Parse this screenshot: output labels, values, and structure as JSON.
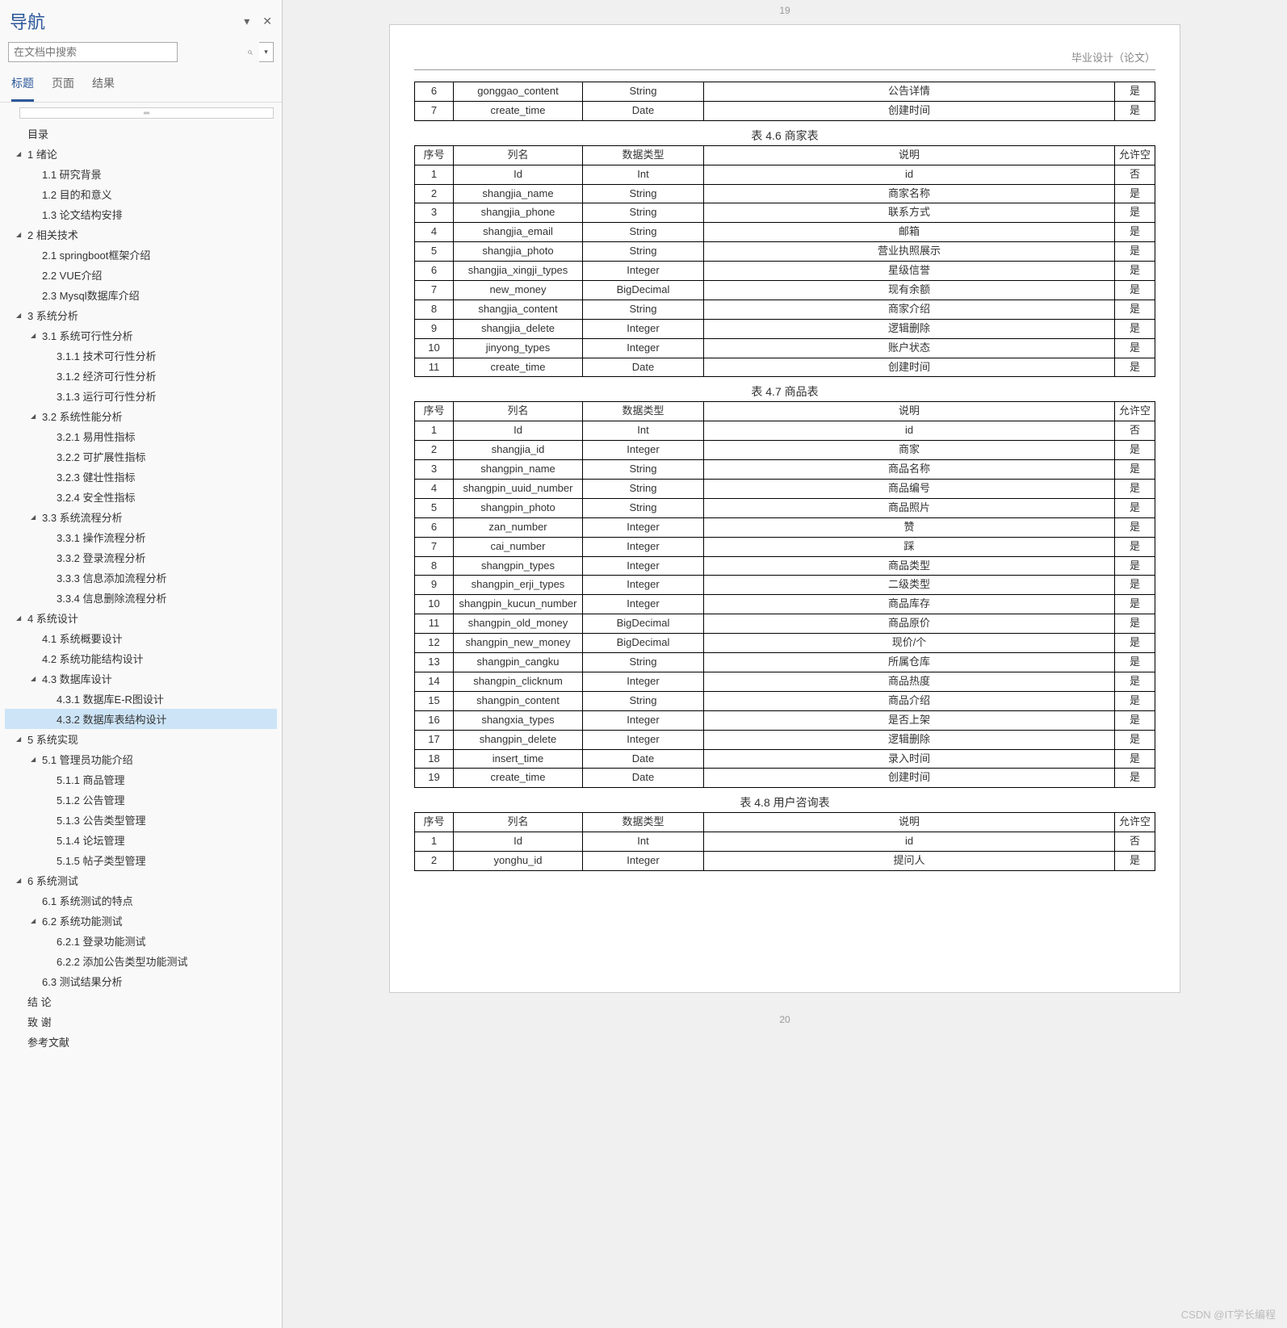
{
  "nav": {
    "title": "导航",
    "searchPlaceholder": "在文档中搜索",
    "tabs": {
      "headings": "标题",
      "pages": "页面",
      "results": "结果"
    },
    "zoomHandle": "⇅"
  },
  "tree": [
    {
      "level": 0,
      "arrow": "",
      "label": "目录"
    },
    {
      "level": 0,
      "arrow": "exp",
      "label": "1 绪论"
    },
    {
      "level": 1,
      "arrow": "",
      "label": "1.1 研究背景"
    },
    {
      "level": 1,
      "arrow": "",
      "label": "1.2 目的和意义"
    },
    {
      "level": 1,
      "arrow": "",
      "label": "1.3 论文结构安排"
    },
    {
      "level": 0,
      "arrow": "exp",
      "label": "2 相关技术"
    },
    {
      "level": 1,
      "arrow": "",
      "label": "2.1 springboot框架介绍"
    },
    {
      "level": 1,
      "arrow": "",
      "label": "2.2 VUE介绍"
    },
    {
      "level": 1,
      "arrow": "",
      "label": "2.3 Mysql数据库介绍"
    },
    {
      "level": 0,
      "arrow": "exp",
      "label": "3 系统分析"
    },
    {
      "level": 1,
      "arrow": "exp",
      "label": "3.1 系统可行性分析"
    },
    {
      "level": 2,
      "arrow": "",
      "label": "3.1.1 技术可行性分析"
    },
    {
      "level": 2,
      "arrow": "",
      "label": "3.1.2 经济可行性分析"
    },
    {
      "level": 2,
      "arrow": "",
      "label": "3.1.3 运行可行性分析"
    },
    {
      "level": 1,
      "arrow": "exp",
      "label": "3.2 系统性能分析"
    },
    {
      "level": 2,
      "arrow": "",
      "label": "3.2.1 易用性指标"
    },
    {
      "level": 2,
      "arrow": "",
      "label": "3.2.2 可扩展性指标"
    },
    {
      "level": 2,
      "arrow": "",
      "label": "3.2.3 健壮性指标"
    },
    {
      "level": 2,
      "arrow": "",
      "label": "3.2.4 安全性指标"
    },
    {
      "level": 1,
      "arrow": "exp",
      "label": "3.3 系统流程分析"
    },
    {
      "level": 2,
      "arrow": "",
      "label": "3.3.1 操作流程分析"
    },
    {
      "level": 2,
      "arrow": "",
      "label": "3.3.2 登录流程分析"
    },
    {
      "level": 2,
      "arrow": "",
      "label": "3.3.3 信息添加流程分析"
    },
    {
      "level": 2,
      "arrow": "",
      "label": "3.3.4 信息删除流程分析"
    },
    {
      "level": 0,
      "arrow": "exp",
      "label": "4 系统设计"
    },
    {
      "level": 1,
      "arrow": "",
      "label": "4.1 系统概要设计"
    },
    {
      "level": 1,
      "arrow": "",
      "label": "4.2 系统功能结构设计"
    },
    {
      "level": 1,
      "arrow": "exp",
      "label": "4.3 数据库设计"
    },
    {
      "level": 2,
      "arrow": "",
      "label": "4.3.1 数据库E-R图设计"
    },
    {
      "level": 2,
      "arrow": "",
      "label": "4.3.2 数据库表结构设计",
      "selected": true
    },
    {
      "level": 0,
      "arrow": "exp",
      "label": "5 系统实现"
    },
    {
      "level": 1,
      "arrow": "exp",
      "label": "5.1 管理员功能介绍"
    },
    {
      "level": 2,
      "arrow": "",
      "label": "5.1.1 商品管理"
    },
    {
      "level": 2,
      "arrow": "",
      "label": "5.1.2 公告管理"
    },
    {
      "level": 2,
      "arrow": "",
      "label": "5.1.3 公告类型管理"
    },
    {
      "level": 2,
      "arrow": "",
      "label": "5.1.4 论坛管理"
    },
    {
      "level": 2,
      "arrow": "",
      "label": "5.1.5 帖子类型管理"
    },
    {
      "level": 0,
      "arrow": "exp",
      "label": "6 系统测试"
    },
    {
      "level": 1,
      "arrow": "",
      "label": "6.1  系统测试的特点  "
    },
    {
      "level": 1,
      "arrow": "exp",
      "label": "6.2 系统功能测试"
    },
    {
      "level": 2,
      "arrow": "",
      "label": "6.2.1 登录功能测试"
    },
    {
      "level": 2,
      "arrow": "",
      "label": "6.2.2 添加公告类型功能测试"
    },
    {
      "level": 1,
      "arrow": "",
      "label": "6.3 测试结果分析"
    },
    {
      "level": 0,
      "arrow": "",
      "label": "结  论"
    },
    {
      "level": 0,
      "arrow": "",
      "label": "致  谢"
    },
    {
      "level": 0,
      "arrow": "",
      "label": "参考文献"
    }
  ],
  "doc": {
    "pageTop": "19",
    "pageBottom": "20",
    "headerText": "毕业设计（论文）",
    "headerCols": [
      "序号",
      "列名",
      "数据类型",
      "说明",
      "允许空"
    ],
    "topRows": [
      [
        "6",
        "gonggao_content",
        "String",
        "公告详情",
        "是"
      ],
      [
        "7",
        "create_time",
        "Date",
        "创建时间",
        "是"
      ]
    ],
    "t46": {
      "caption": "表 4.6 商家表",
      "rows": [
        [
          "1",
          "Id",
          "Int",
          "id",
          "否"
        ],
        [
          "2",
          "shangjia_name",
          "String",
          "商家名称",
          "是"
        ],
        [
          "3",
          "shangjia_phone",
          "String",
          "联系方式",
          "是"
        ],
        [
          "4",
          "shangjia_email",
          "String",
          "邮箱",
          "是"
        ],
        [
          "5",
          "shangjia_photo",
          "String",
          "营业执照展示",
          "是"
        ],
        [
          "6",
          "shangjia_xingji_types",
          "Integer",
          "星级信誉",
          "是"
        ],
        [
          "7",
          "new_money",
          "BigDecimal",
          "现有余额",
          "是"
        ],
        [
          "8",
          "shangjia_content",
          "String",
          "商家介绍",
          "是"
        ],
        [
          "9",
          "shangjia_delete",
          "Integer",
          "逻辑删除",
          "是"
        ],
        [
          "10",
          "jinyong_types",
          "Integer",
          "账户状态",
          "是"
        ],
        [
          "11",
          "create_time",
          "Date",
          "创建时间",
          "是"
        ]
      ]
    },
    "t47": {
      "caption": "表 4.7 商品表",
      "rows": [
        [
          "1",
          "Id",
          "Int",
          "id",
          "否"
        ],
        [
          "2",
          "shangjia_id",
          "Integer",
          "商家",
          "是"
        ],
        [
          "3",
          "shangpin_name",
          "String",
          "商品名称",
          "是"
        ],
        [
          "4",
          "shangpin_uuid_number",
          "String",
          "商品编号",
          "是"
        ],
        [
          "5",
          "shangpin_photo",
          "String",
          "商品照片",
          "是"
        ],
        [
          "6",
          "zan_number",
          "Integer",
          "赞",
          "是"
        ],
        [
          "7",
          "cai_number",
          "Integer",
          "踩",
          "是"
        ],
        [
          "8",
          "shangpin_types",
          "Integer",
          "商品类型",
          "是"
        ],
        [
          "9",
          "shangpin_erji_types",
          "Integer",
          "二级类型",
          "是"
        ],
        [
          "10",
          "shangpin_kucun_number",
          "Integer",
          "商品库存",
          "是"
        ],
        [
          "11",
          "shangpin_old_money",
          "BigDecimal",
          "商品原价",
          "是"
        ],
        [
          "12",
          "shangpin_new_money",
          "BigDecimal",
          "现价/个",
          "是"
        ],
        [
          "13",
          "shangpin_cangku",
          "String",
          "所属仓库",
          "是"
        ],
        [
          "14",
          "shangpin_clicknum",
          "Integer",
          "商品热度",
          "是"
        ],
        [
          "15",
          "shangpin_content",
          "String",
          "商品介绍",
          "是"
        ],
        [
          "16",
          "shangxia_types",
          "Integer",
          "是否上架",
          "是"
        ],
        [
          "17",
          "shangpin_delete",
          "Integer",
          "逻辑删除",
          "是"
        ],
        [
          "18",
          "insert_time",
          "Date",
          "录入时间",
          "是"
        ],
        [
          "19",
          "create_time",
          "Date",
          "创建时间",
          "是"
        ]
      ]
    },
    "t48": {
      "caption": "表 4.8 用户咨询表",
      "rows": [
        [
          "1",
          "Id",
          "Int",
          "id",
          "否"
        ],
        [
          "2",
          "yonghu_id",
          "Integer",
          "提问人",
          "是"
        ]
      ]
    }
  },
  "watermark": "CSDN @IT学长编程"
}
